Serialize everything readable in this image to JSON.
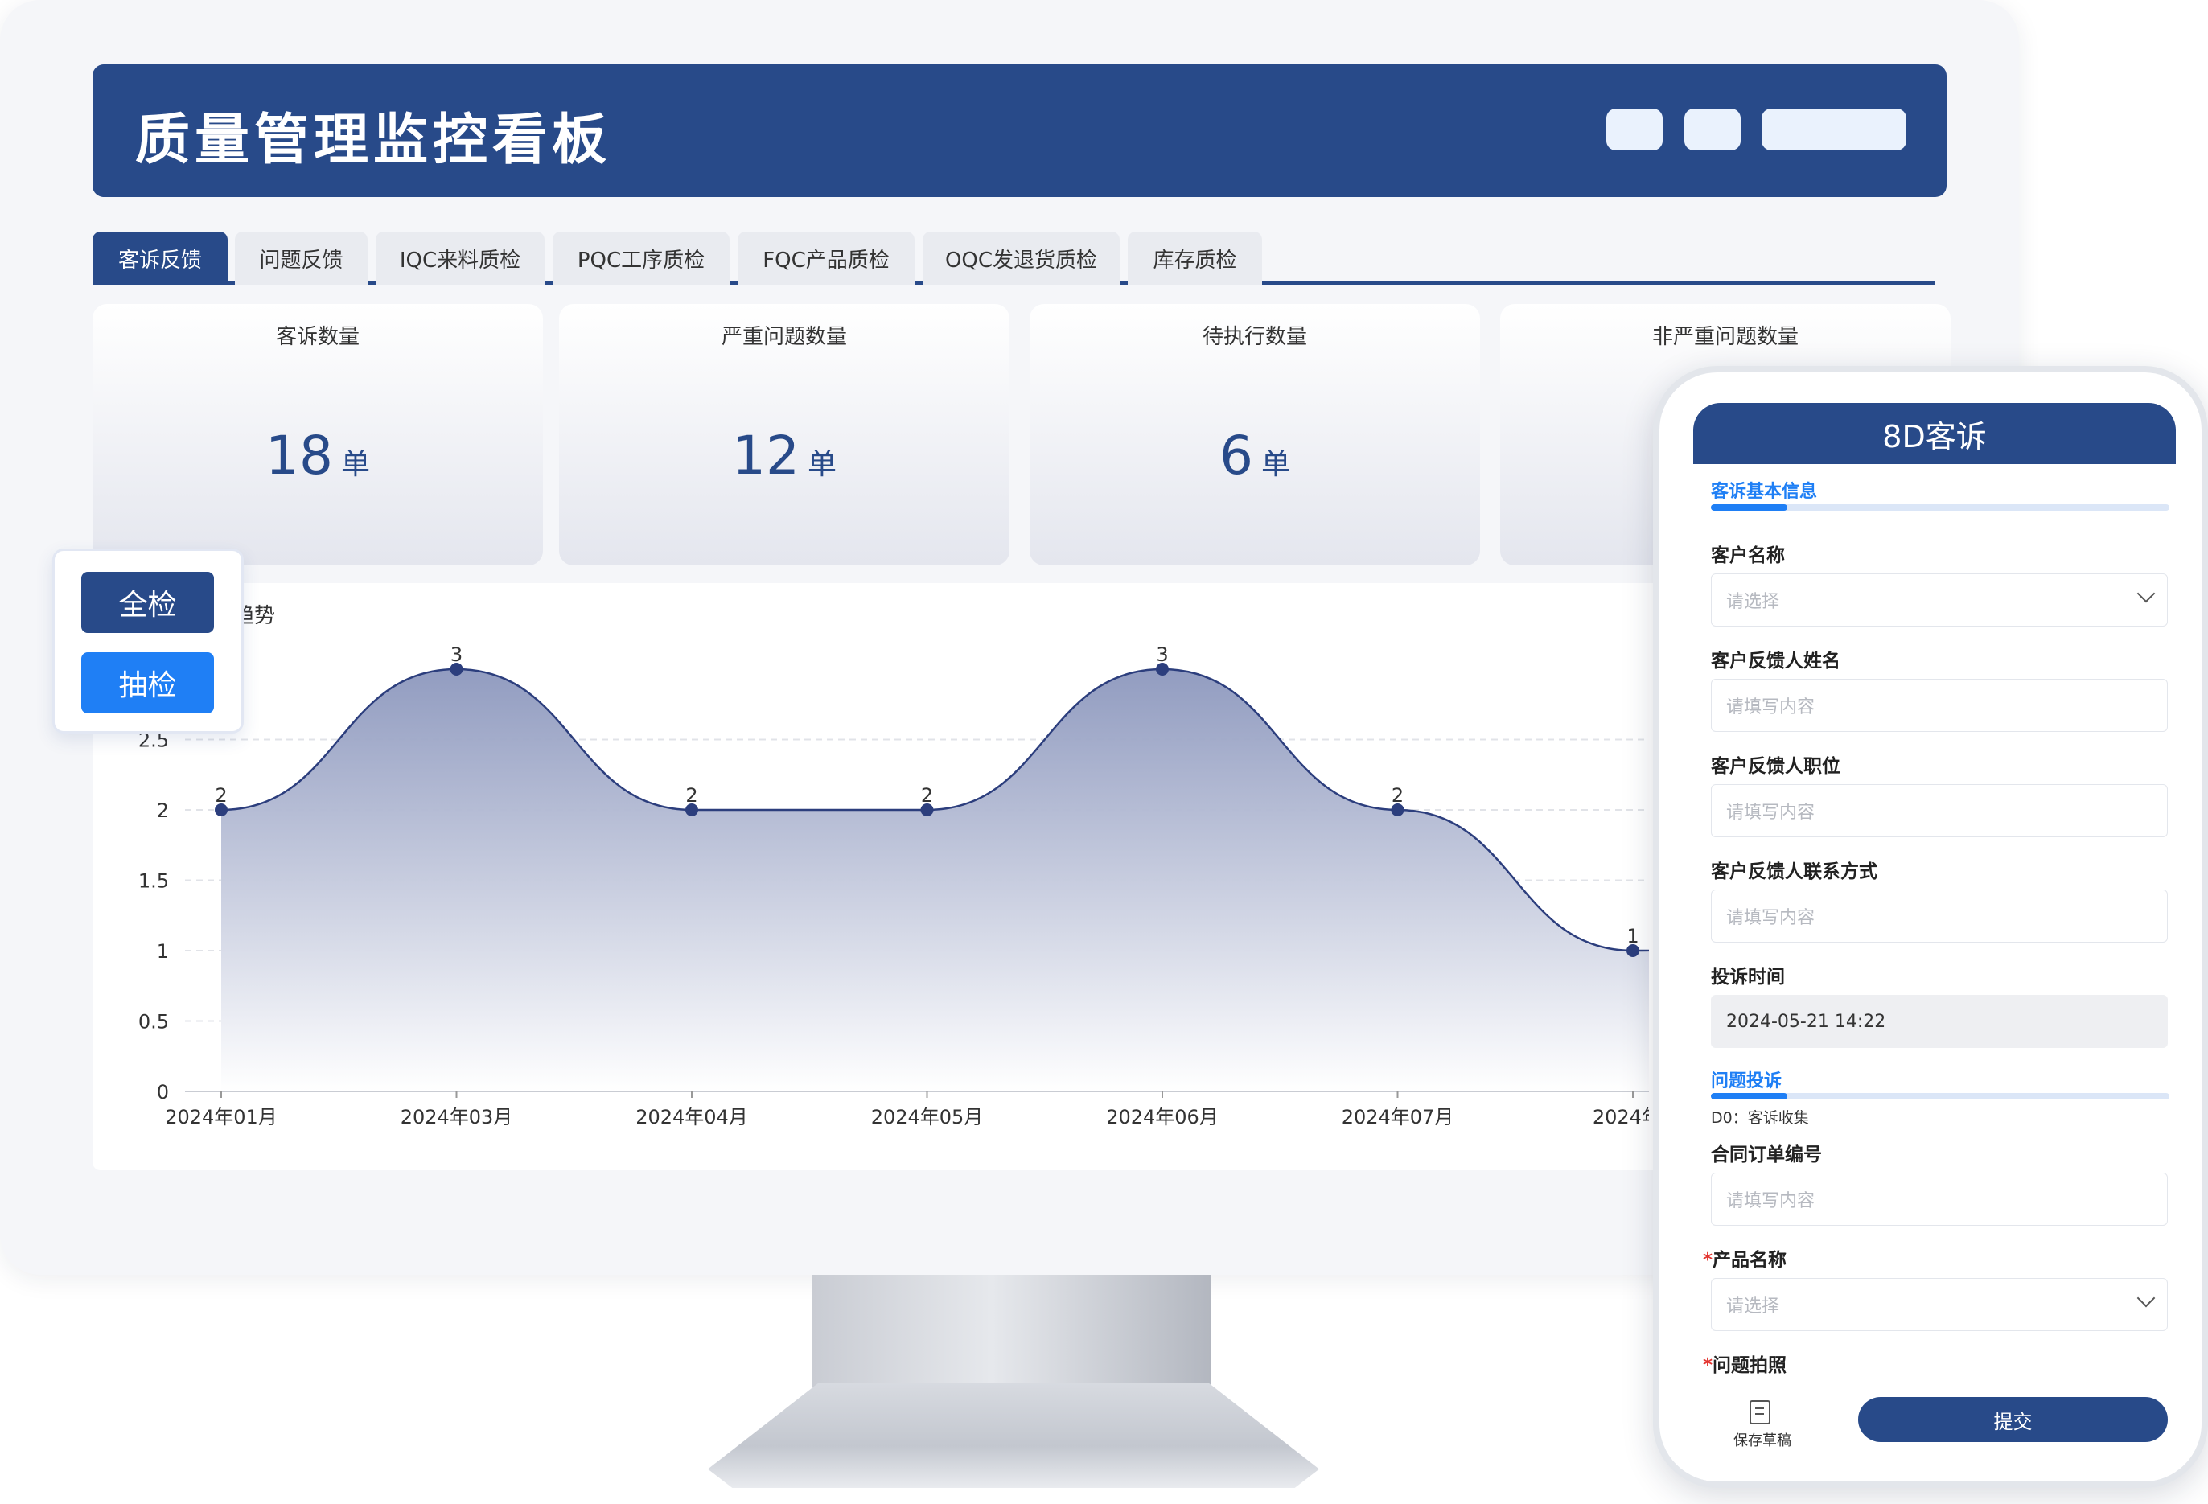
{
  "dashboard": {
    "title": "质量管理监控看板",
    "tabs": [
      {
        "label": "客诉反馈",
        "active": true
      },
      {
        "label": "问题反馈",
        "active": false
      },
      {
        "label": "IQC来料质检",
        "active": false
      },
      {
        "label": "PQC工序质检",
        "active": false
      },
      {
        "label": "FQC产品质检",
        "active": false
      },
      {
        "label": "OQC发退货质检",
        "active": false
      },
      {
        "label": "库存质检",
        "active": false
      }
    ],
    "stats": [
      {
        "label": "客诉数量",
        "value": "18",
        "unit": "单"
      },
      {
        "label": "严重问题数量",
        "value": "12",
        "unit": "单"
      },
      {
        "label": "待执行数量",
        "value": "6",
        "unit": "单"
      },
      {
        "label": "非严重问题数量",
        "value": "",
        "unit": ""
      }
    ],
    "chart_partial_title": "趋势"
  },
  "inspection_toggle": {
    "full_label": "全检",
    "sample_label": "抽检"
  },
  "chart_data": {
    "type": "area",
    "title": "趋势",
    "x": [
      "2024年01月",
      "2024年03月",
      "2024年04月",
      "2024年05月",
      "2024年06月",
      "2024年07月",
      "2024年0"
    ],
    "y": [
      2,
      3,
      2,
      2,
      3,
      2,
      1
    ],
    "data_labels": [
      "2",
      "3",
      "2",
      "2",
      "3",
      "2",
      "1"
    ],
    "yticks": [
      "0",
      "0.5",
      "1",
      "1.5",
      "2",
      "2.5"
    ],
    "ylim": [
      0,
      3
    ],
    "grid": true,
    "colors": {
      "line": "#2c3e7d",
      "fill_top": "#8c97bd",
      "fill_bottom": "#ffffff"
    }
  },
  "phone": {
    "title": "8D客诉",
    "section1": "客诉基本信息",
    "customer_name": {
      "label": "客户名称",
      "placeholder": "请选择"
    },
    "feedback_name": {
      "label": "客户反馈人姓名",
      "placeholder": "请填写内容"
    },
    "feedback_position": {
      "label": "客户反馈人职位",
      "placeholder": "请填写内容"
    },
    "feedback_contact": {
      "label": "客户反馈人联系方式",
      "placeholder": "请填写内容"
    },
    "complaint_time": {
      "label": "投诉时间",
      "value": "2024-05-21 14:22"
    },
    "section2": "问题投诉",
    "step_note": "D0：客诉收集",
    "contract_no": {
      "label": "合同订单编号",
      "placeholder": "请填写内容"
    },
    "product_name": {
      "label": "产品名称",
      "placeholder": "请选择",
      "required_mark": "*"
    },
    "problem_photo": {
      "label": "问题拍照",
      "required_mark": "*"
    },
    "save_draft_label": "保存草稿",
    "submit_label": "提交"
  },
  "colors": {
    "primary": "#284a89",
    "accent_blue": "#1f7ff5",
    "required_red": "#e3342f"
  }
}
